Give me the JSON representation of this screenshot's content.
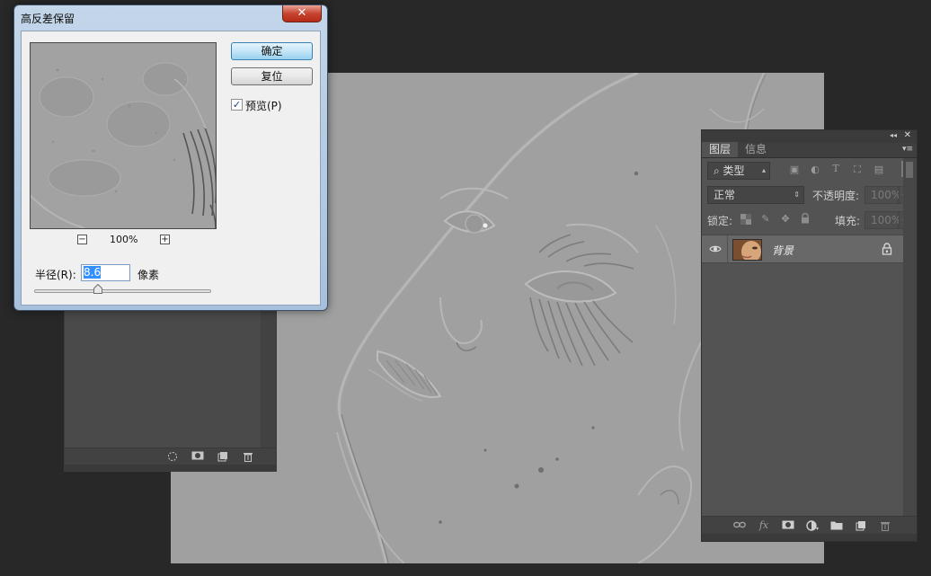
{
  "dialog": {
    "title": "高反差保留",
    "close_label": "✕",
    "ok_label": "确定",
    "reset_label": "复位",
    "preview_label": "预览(P)",
    "preview_checked": "✓",
    "zoom_level": "100%",
    "zoom_out": "−",
    "zoom_in": "+",
    "radius_label": "半径(R):",
    "radius_value": "8.6",
    "radius_unit": "像素",
    "radius_slider_fraction": 0.36
  },
  "layers_panel": {
    "tabs": [
      {
        "label": "图层"
      },
      {
        "label": "信息"
      }
    ],
    "filter_kind": "类型",
    "blend_mode": "正常",
    "opacity_label": "不透明度:",
    "opacity_value": "100%",
    "lock_label": "锁定:",
    "fill_label": "填充:",
    "fill_value": "100%",
    "layers": [
      {
        "name": "背景",
        "locked": true,
        "visible": true
      }
    ],
    "footer_icons": [
      "link-icon",
      "fx-icon",
      "mask-icon",
      "adjustment-icon",
      "folder-icon",
      "new-layer-icon",
      "trash-icon"
    ],
    "fx_label": "fx"
  },
  "left_panel": {
    "footer_icons": [
      "selection-icon",
      "mask-icon",
      "new-icon",
      "trash-icon"
    ]
  },
  "colors": {
    "workspace": "#282828",
    "panel": "#535353",
    "canvas_gray": "#9f9f9f",
    "dialog_default_button": "#98d1ef"
  }
}
